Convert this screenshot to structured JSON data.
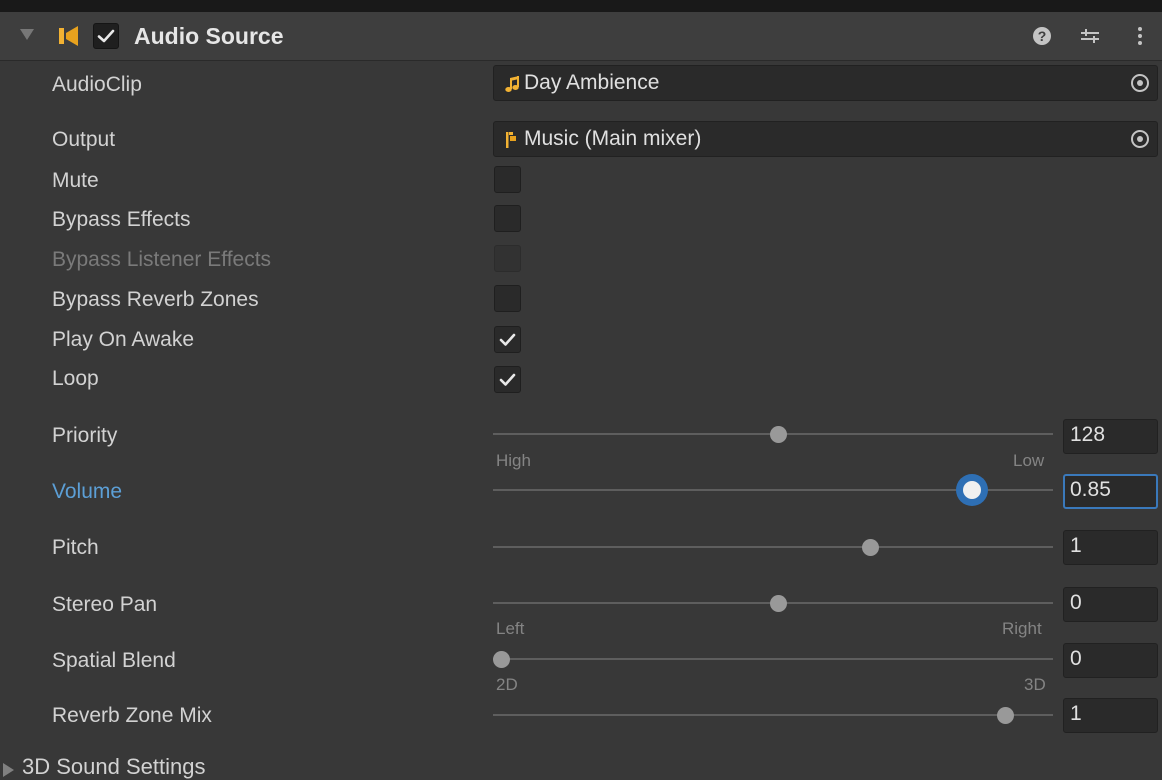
{
  "component": {
    "title": "Audio Source",
    "enabled": true
  },
  "properties": {
    "audioclip": {
      "label": "AudioClip",
      "value": "Day Ambience",
      "icon": "audio-clip-icon"
    },
    "output": {
      "label": "Output",
      "value": "Music (Main mixer)",
      "icon": "mixer-group-icon"
    },
    "mute": {
      "label": "Mute",
      "checked": false
    },
    "bypass_effects": {
      "label": "Bypass Effects",
      "checked": false
    },
    "bypass_listener_effects": {
      "label": "Bypass Listener Effects",
      "checked": false,
      "disabled": true
    },
    "bypass_reverb_zones": {
      "label": "Bypass Reverb Zones",
      "checked": false
    },
    "play_on_awake": {
      "label": "Play On Awake",
      "checked": true
    },
    "loop": {
      "label": "Loop",
      "checked": true
    },
    "priority": {
      "label": "Priority",
      "value": "128",
      "min": 0,
      "max": 256,
      "current": 128,
      "left_label": "High",
      "right_label": "Low"
    },
    "volume": {
      "label": "Volume",
      "value": "0.85",
      "min": 0,
      "max": 1,
      "current": 0.85
    },
    "pitch": {
      "label": "Pitch",
      "value": "1",
      "min": -3,
      "max": 3,
      "current": 1
    },
    "stereo_pan": {
      "label": "Stereo Pan",
      "value": "0",
      "min": -1,
      "max": 1,
      "current": 0,
      "left_label": "Left",
      "right_label": "Right"
    },
    "spatial_blend": {
      "label": "Spatial Blend",
      "value": "0",
      "min": 0,
      "max": 1,
      "current": 0,
      "left_label": "2D",
      "right_label": "3D"
    },
    "reverb_zone_mix": {
      "label": "Reverb Zone Mix",
      "value": "1",
      "min": 0,
      "max": 1.1,
      "current": 1
    }
  },
  "foldout": {
    "label": "3D Sound Settings",
    "expanded": false
  },
  "colors": {
    "background": "#383838",
    "focus_blue": "#3a79bb",
    "label_focus": "#5c9fd6",
    "icon_orange": "#f2b233"
  }
}
